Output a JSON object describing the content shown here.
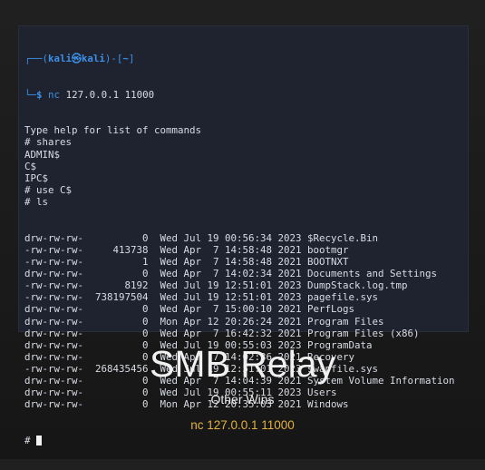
{
  "terminal": {
    "prompt_user": "kali",
    "prompt_at": "㉿",
    "prompt_host": "kali",
    "prompt_dir": "~",
    "command": "nc 127.0.0.1 11000",
    "output_lines": [
      "Type help for list of commands",
      "# shares",
      "ADMIN$",
      "C$",
      "IPC$",
      "# use C$",
      "# ls"
    ],
    "listing": [
      {
        "perm": "drw-rw-rw-",
        "size": "0",
        "date": "Wed Jul 19 00:56:34 2023",
        "name": "$Recycle.Bin"
      },
      {
        "perm": "-rw-rw-rw-",
        "size": "413738",
        "date": "Wed Apr  7 14:58:48 2021",
        "name": "bootmgr"
      },
      {
        "perm": "-rw-rw-rw-",
        "size": "1",
        "date": "Wed Apr  7 14:58:48 2021",
        "name": "BOOTNXT"
      },
      {
        "perm": "drw-rw-rw-",
        "size": "0",
        "date": "Wed Apr  7 14:02:34 2021",
        "name": "Documents and Settings"
      },
      {
        "perm": "-rw-rw-rw-",
        "size": "8192",
        "date": "Wed Jul 19 12:51:01 2023",
        "name": "DumpStack.log.tmp"
      },
      {
        "perm": "-rw-rw-rw-",
        "size": "738197504",
        "date": "Wed Jul 19 12:51:01 2023",
        "name": "pagefile.sys"
      },
      {
        "perm": "drw-rw-rw-",
        "size": "0",
        "date": "Wed Apr  7 15:00:10 2021",
        "name": "PerfLogs"
      },
      {
        "perm": "drw-rw-rw-",
        "size": "0",
        "date": "Mon Apr 12 20:26:24 2021",
        "name": "Program Files"
      },
      {
        "perm": "drw-rw-rw-",
        "size": "0",
        "date": "Wed Apr  7 16:42:32 2021",
        "name": "Program Files (x86)"
      },
      {
        "perm": "drw-rw-rw-",
        "size": "0",
        "date": "Wed Jul 19 00:55:03 2023",
        "name": "ProgramData"
      },
      {
        "perm": "drw-rw-rw-",
        "size": "0",
        "date": "Wed Apr  7 14:02:36 2021",
        "name": "Recovery"
      },
      {
        "perm": "-rw-rw-rw-",
        "size": "268435456",
        "date": "Wed Jul 19 12:51:01 2023",
        "name": "swapfile.sys"
      },
      {
        "perm": "drw-rw-rw-",
        "size": "0",
        "date": "Wed Apr  7 14:04:39 2021",
        "name": "System Volume Information"
      },
      {
        "perm": "drw-rw-rw-",
        "size": "0",
        "date": "Wed Jul 19 00:55:11 2023",
        "name": "Users"
      },
      {
        "perm": "drw-rw-rw-",
        "size": "0",
        "date": "Mon Apr 12 20:35:03 2021",
        "name": "Windows"
      }
    ],
    "final_prompt": "#"
  },
  "slide": {
    "title": "SMB Relay",
    "subtitle": "Other Wins",
    "command": "nc 127.0.0.1 11000"
  }
}
